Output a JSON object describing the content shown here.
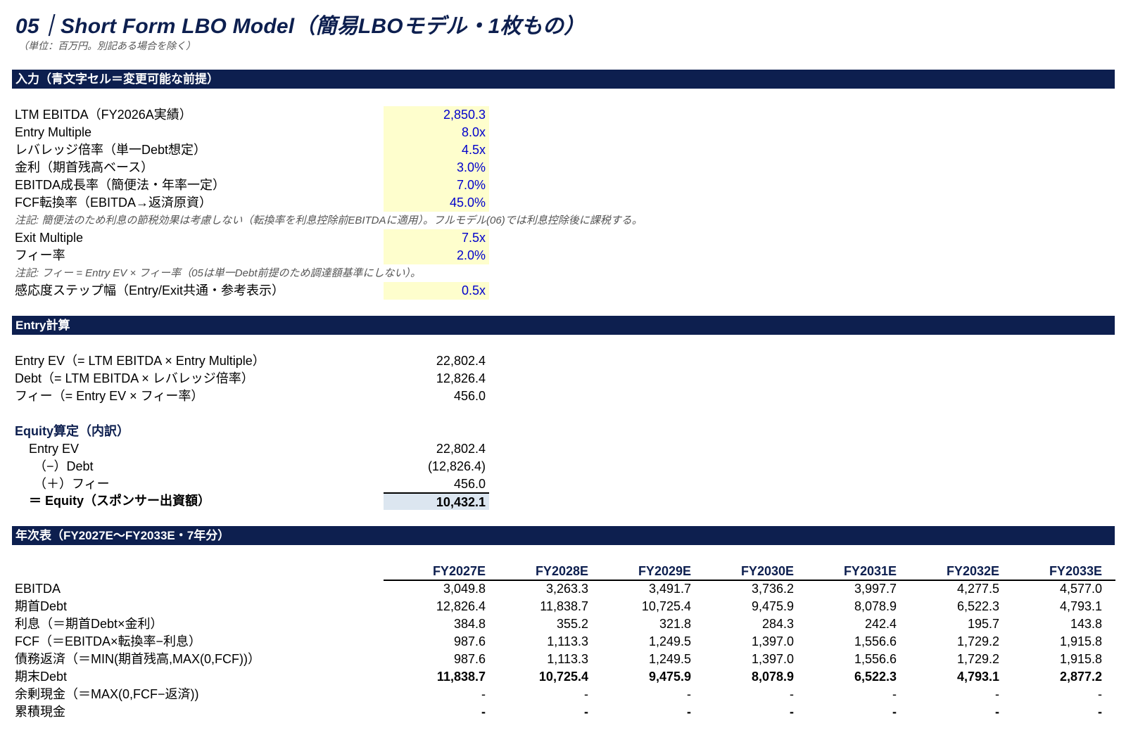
{
  "title": "05｜Short Form LBO Model（簡易LBOモデル・1枚もの）",
  "subtitle": "（単位：百万円。別記ある場合を除く）",
  "sections": {
    "inputs": "入力（青文字セル＝変更可能な前提）",
    "entry": "Entry計算",
    "annual": "年次表（FY2027E〜FY2033E・7年分）"
  },
  "inputs": {
    "ltm_ebitda": {
      "label": "LTM EBITDA（FY2026A実績）",
      "value": "2,850.3"
    },
    "entry_multiple": {
      "label": "Entry Multiple",
      "value": "8.0x"
    },
    "leverage": {
      "label": "レバレッジ倍率（単一Debt想定）",
      "value": "4.5x"
    },
    "interest": {
      "label": "金利（期首残高ベース）",
      "value": "3.0%"
    },
    "growth": {
      "label": "EBITDA成長率（簡便法・年率一定）",
      "value": "7.0%"
    },
    "fcf_conv": {
      "label": "FCF転換率（EBITDA→返済原資）",
      "value": "45.0%"
    },
    "note1": "注記: 簡便法のため利息の節税効果は考慮しない（転換率を利息控除前EBITDAに適用）。フルモデル(06)では利息控除後に課税する。",
    "exit_multiple": {
      "label": "Exit Multiple",
      "value": "7.5x"
    },
    "fee_rate": {
      "label": "フィー率",
      "value": "2.0%"
    },
    "note2": "注記: フィー = Entry EV × フィー率（05は単一Debt前提のため調達額基準にしない）。",
    "sens_step": {
      "label": "感応度ステップ幅（Entry/Exit共通・参考表示）",
      "value": "0.5x"
    }
  },
  "entry": {
    "entry_ev": {
      "label": "Entry EV（= LTM EBITDA × Entry Multiple）",
      "value": "22,802.4"
    },
    "debt": {
      "label": "Debt（= LTM EBITDA × レバレッジ倍率）",
      "value": "12,826.4"
    },
    "fee": {
      "label": "フィー（= Entry EV × フィー率）",
      "value": "456.0"
    },
    "equity_header": "Equity算定（内訳）",
    "bd_ev": {
      "label": "Entry EV",
      "value": "22,802.4"
    },
    "bd_debt": {
      "label": "（−）Debt",
      "value": "(12,826.4)"
    },
    "bd_fee": {
      "label": "（＋）フィー",
      "value": "456.0"
    },
    "bd_equity": {
      "label": "＝ Equity（スポンサー出資額）",
      "value": "10,432.1"
    }
  },
  "annual": {
    "years": [
      "FY2027E",
      "FY2028E",
      "FY2029E",
      "FY2030E",
      "FY2031E",
      "FY2032E",
      "FY2033E"
    ],
    "rows": [
      {
        "label": "EBITDA",
        "bold": false,
        "values": [
          "3,049.8",
          "3,263.3",
          "3,491.7",
          "3,736.2",
          "3,997.7",
          "4,277.5",
          "4,577.0"
        ]
      },
      {
        "label": "期首Debt",
        "bold": false,
        "values": [
          "12,826.4",
          "11,838.7",
          "10,725.4",
          "9,475.9",
          "8,078.9",
          "6,522.3",
          "4,793.1"
        ]
      },
      {
        "label": "利息（＝期首Debt×金利）",
        "bold": false,
        "values": [
          "384.8",
          "355.2",
          "321.8",
          "284.3",
          "242.4",
          "195.7",
          "143.8"
        ]
      },
      {
        "label": "FCF（＝EBITDA×転換率−利息）",
        "bold": false,
        "values": [
          "987.6",
          "1,113.3",
          "1,249.5",
          "1,397.0",
          "1,556.6",
          "1,729.2",
          "1,915.8"
        ]
      },
      {
        "label": "債務返済（＝MIN(期首残高,MAX(0,FCF))）",
        "bold": false,
        "values": [
          "987.6",
          "1,113.3",
          "1,249.5",
          "1,397.0",
          "1,556.6",
          "1,729.2",
          "1,915.8"
        ]
      },
      {
        "label": "期末Debt",
        "bold": true,
        "values": [
          "11,838.7",
          "10,725.4",
          "9,475.9",
          "8,078.9",
          "6,522.3",
          "4,793.1",
          "2,877.2"
        ]
      },
      {
        "label": "余剰現金（＝MAX(0,FCF−返済))",
        "bold": false,
        "values": [
          "-",
          "-",
          "-",
          "-",
          "-",
          "-",
          "-"
        ]
      },
      {
        "label": "累積現金",
        "bold": true,
        "values": [
          "-",
          "-",
          "-",
          "-",
          "-",
          "-",
          "-"
        ]
      }
    ]
  },
  "colors": {
    "navy": "#0d1f4f",
    "input_bg": "#fefecd",
    "input_text": "#0000cc",
    "total_bg": "#dce6f0"
  }
}
